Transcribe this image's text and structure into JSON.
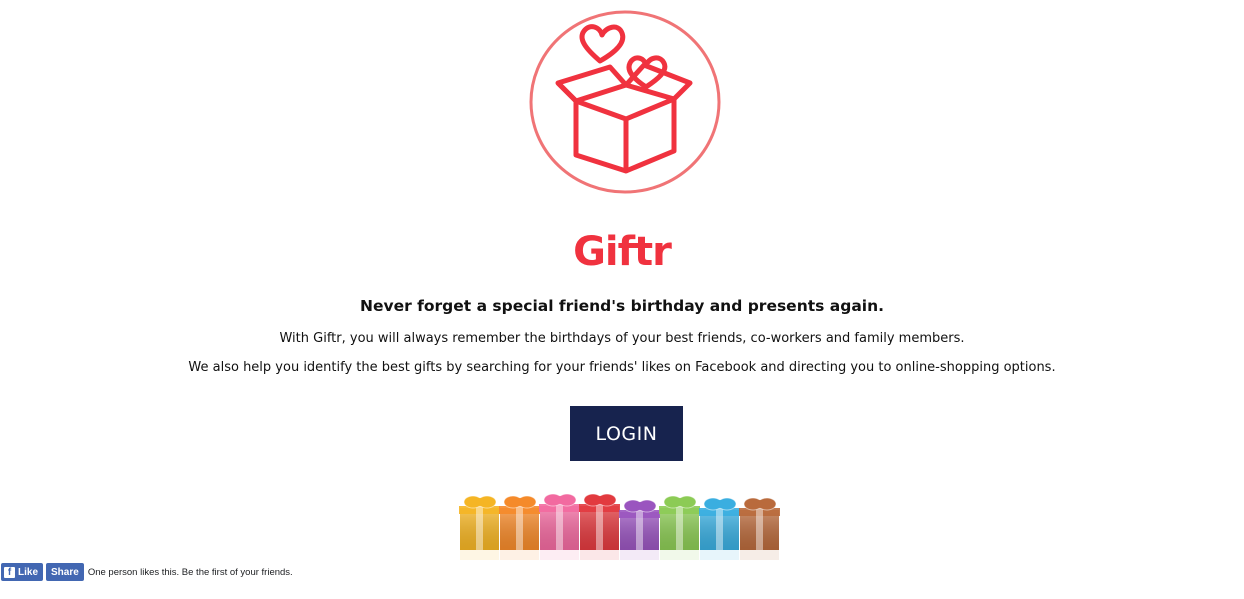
{
  "colors": {
    "brand_red": "#f0323f",
    "logo_circle": "#f07476",
    "login_bg": "#17234e",
    "facebook_blue": "#4267b2"
  },
  "logo": {
    "icon": "gift-box-with-hearts-icon"
  },
  "brand": {
    "name": "Giftr"
  },
  "hero": {
    "tagline": "Never forget a special friend's birthday and presents again.",
    "description_1": "With Giftr, you will always remember the birthdays of your best friends, co-workers and family members.",
    "description_2": "We also help you identify the best gifts by searching for your friends' likes on Facebook and directing you to online-shopping options."
  },
  "actions": {
    "login_label": "LOGIN"
  },
  "gifts_image": {
    "icon": "colorful-gift-boxes-image",
    "box_colors": [
      "#f5b524",
      "#f58a2a",
      "#f26aa0",
      "#e23a3f",
      "#9a55bf",
      "#8ccb55",
      "#3aaee0",
      "#b96a3c"
    ]
  },
  "facebook": {
    "like_label": "Like",
    "share_label": "Share",
    "like_text": "One person likes this. Be the first of your friends."
  }
}
